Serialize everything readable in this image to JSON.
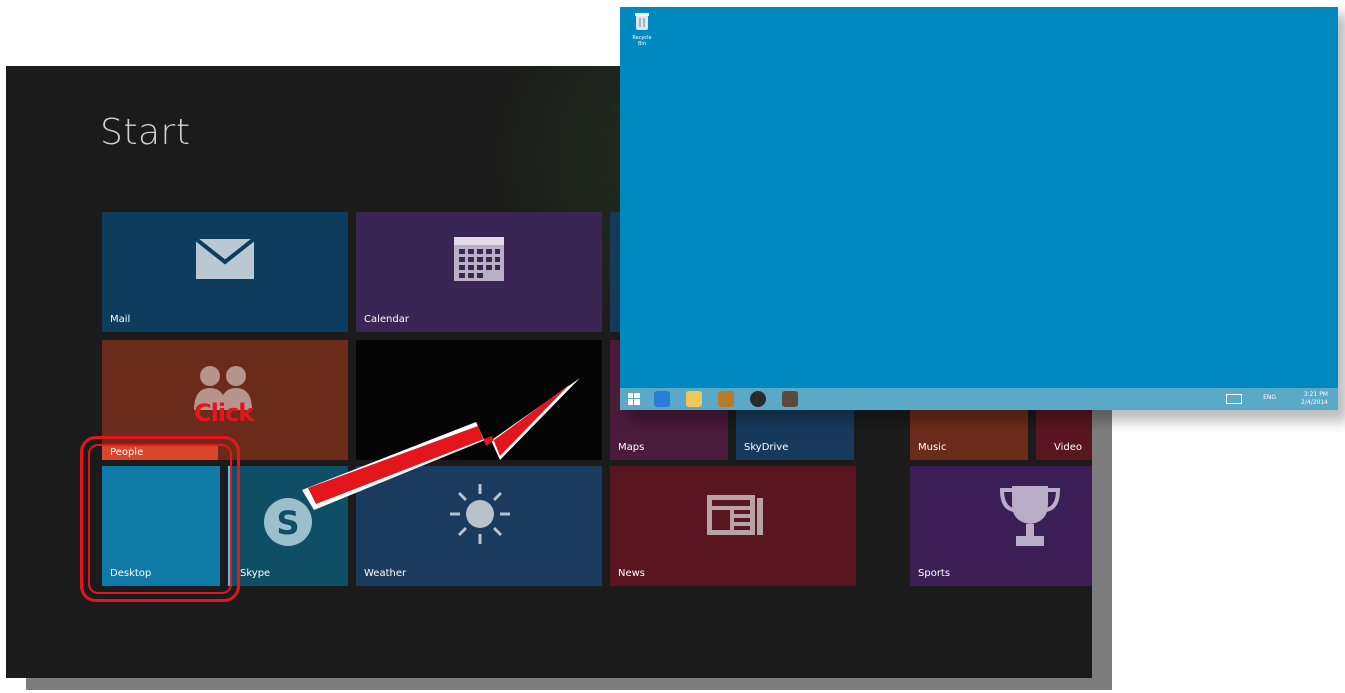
{
  "start": {
    "title": "Start",
    "tiles": {
      "mail": "Mail",
      "calendar": "Calendar",
      "people": "People",
      "desktop": "Desktop",
      "skype": "Skype",
      "weather": "Weather",
      "maps": "Maps",
      "skydrive": "SkyDrive",
      "news": "News",
      "music": "Music",
      "video": "Video",
      "sports": "Sports"
    }
  },
  "annotation": {
    "click_text": "Click"
  },
  "desktop": {
    "recycle_bin_label": "Recycle Bin",
    "tray": {
      "language": "ENG",
      "time": "3:21 PM",
      "date": "2/4/2014"
    }
  },
  "colors": {
    "desktop_bg": "#0089be",
    "start_bg": "#1b1b1b",
    "highlight": "#e2161c"
  },
  "icons": [
    "envelope-icon",
    "calendar-icon",
    "people-icon",
    "skype-icon",
    "sun-icon",
    "news-icon",
    "trophy-icon",
    "windows-logo-icon",
    "ie-icon",
    "folder-icon",
    "recycle-bin-icon"
  ]
}
